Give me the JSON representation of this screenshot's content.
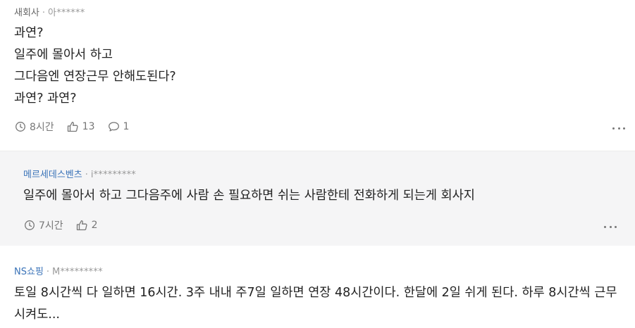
{
  "comments": [
    {
      "company": "새회사",
      "user": "아******",
      "lines": [
        "과연?",
        "일주에 몰아서 하고",
        "그다음엔 연장근무 안해도된다?",
        "과연? 과연?"
      ],
      "time": "8시간",
      "likes": "13",
      "replies": "1"
    },
    {
      "company": "메르세데스벤츠",
      "user": "i*********",
      "lines": [
        "일주에 몰아서 하고 그다음주에 사람 손 필요하면 쉬는 사람한테 전화하게 되는게 회사지"
      ],
      "time": "7시간",
      "likes": "2"
    },
    {
      "company": "NS쇼핑",
      "user": "M*********",
      "text": "토일 8시간씩 다 일하면 16시간. 3주 내내 주7일 일하면 연장 48시간이다. 한달에 2일 쉬게 된다. 하루 8시간씩 근무시켜도..."
    }
  ],
  "colors": {
    "reply_bg": "#f5f5f6",
    "company_link": "#3a73b8",
    "muted": "#999999"
  }
}
